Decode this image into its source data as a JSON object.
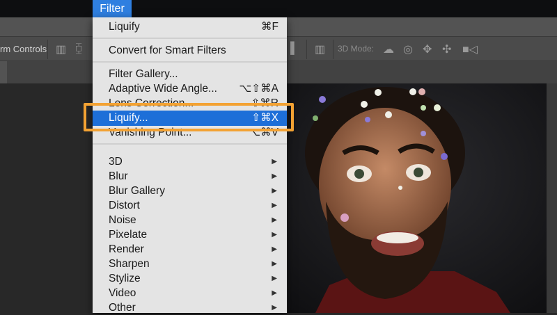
{
  "menubar": {
    "active_menu": "Filter"
  },
  "options_bar": {
    "transform_controls_label": "rm Controls",
    "mode_label": "3D Mode:"
  },
  "menu": {
    "items": [
      {
        "label": "Liquify",
        "shortcut": "⌘F"
      },
      {
        "label": "Convert for Smart Filters",
        "shortcut": ""
      },
      {
        "label": "Filter Gallery...",
        "shortcut": ""
      },
      {
        "label": "Adaptive Wide Angle...",
        "shortcut": "⌥⇧⌘A"
      },
      {
        "label": "Lens Correction...",
        "shortcut": "⇧⌘R"
      },
      {
        "label": "Liquify...",
        "shortcut": "⇧⌘X"
      },
      {
        "label": "Vanishing Point...",
        "shortcut": "⌥⌘V"
      }
    ],
    "submenus": [
      "3D",
      "Blur",
      "Blur Gallery",
      "Distort",
      "Noise",
      "Pixelate",
      "Render",
      "Sharpen",
      "Stylize",
      "Video",
      "Other"
    ],
    "submenu_arrow": "▶"
  },
  "colors": {
    "highlight": "#1d6fd8",
    "callout": "#f3a233",
    "menubar_active": "#2f7fe0"
  }
}
